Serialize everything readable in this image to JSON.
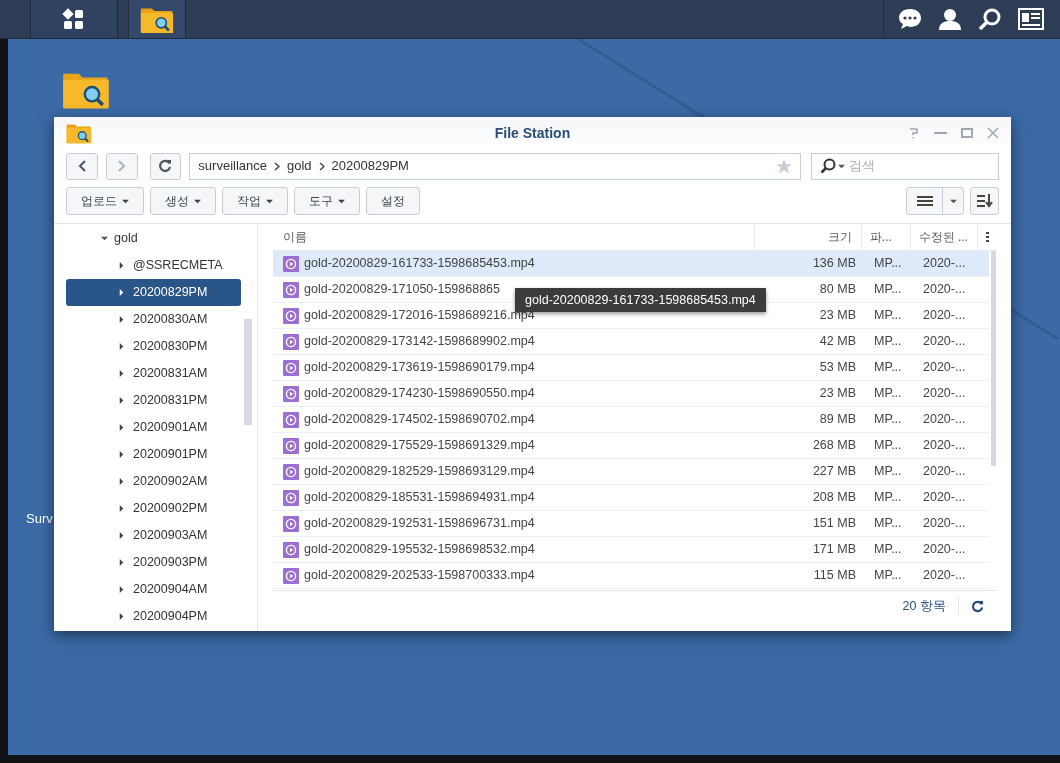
{
  "desktop": {
    "icon_label": "Surv"
  },
  "window": {
    "title": "File Station"
  },
  "path": {
    "segments": [
      "surveillance",
      "gold",
      "20200829PM"
    ]
  },
  "search": {
    "placeholder": "검색"
  },
  "toolbar": {
    "buttons": [
      {
        "label": "업로드",
        "dropdown": true
      },
      {
        "label": "생성",
        "dropdown": true
      },
      {
        "label": "작업",
        "dropdown": true
      },
      {
        "label": "도구",
        "dropdown": true
      },
      {
        "label": "설정",
        "dropdown": false
      }
    ]
  },
  "tree": {
    "label": "gold",
    "expanded": true,
    "children": [
      {
        "label": "@SSRECMETA",
        "selected": false
      },
      {
        "label": "20200829PM",
        "selected": true
      },
      {
        "label": "20200830AM",
        "selected": false
      },
      {
        "label": "20200830PM",
        "selected": false
      },
      {
        "label": "20200831AM",
        "selected": false
      },
      {
        "label": "20200831PM",
        "selected": false
      },
      {
        "label": "20200901AM",
        "selected": false
      },
      {
        "label": "20200901PM",
        "selected": false
      },
      {
        "label": "20200902AM",
        "selected": false
      },
      {
        "label": "20200902PM",
        "selected": false
      },
      {
        "label": "20200903AM",
        "selected": false
      },
      {
        "label": "20200903PM",
        "selected": false
      },
      {
        "label": "20200904AM",
        "selected": false
      },
      {
        "label": "20200904PM",
        "selected": false
      }
    ]
  },
  "table": {
    "columns": [
      "이름",
      "크기",
      "파...",
      "수정된 ..."
    ],
    "rows": [
      {
        "name": "gold-20200829-161733-1598685453.mp4",
        "size": "136 MB",
        "type": "MP...",
        "modified": "2020-...",
        "selected": true
      },
      {
        "name": "gold-20200829-171050-159868865",
        "size": "80 MB",
        "type": "MP...",
        "modified": "2020-...",
        "selected": false
      },
      {
        "name": "gold-20200829-172016-1598689216.mp4",
        "size": "23 MB",
        "type": "MP...",
        "modified": "2020-...",
        "selected": false
      },
      {
        "name": "gold-20200829-173142-1598689902.mp4",
        "size": "42 MB",
        "type": "MP...",
        "modified": "2020-...",
        "selected": false
      },
      {
        "name": "gold-20200829-173619-1598690179.mp4",
        "size": "53 MB",
        "type": "MP...",
        "modified": "2020-...",
        "selected": false
      },
      {
        "name": "gold-20200829-174230-1598690550.mp4",
        "size": "23 MB",
        "type": "MP...",
        "modified": "2020-...",
        "selected": false
      },
      {
        "name": "gold-20200829-174502-1598690702.mp4",
        "size": "89 MB",
        "type": "MP...",
        "modified": "2020-...",
        "selected": false
      },
      {
        "name": "gold-20200829-175529-1598691329.mp4",
        "size": "268 MB",
        "type": "MP...",
        "modified": "2020-...",
        "selected": false
      },
      {
        "name": "gold-20200829-182529-1598693129.mp4",
        "size": "227 MB",
        "type": "MP...",
        "modified": "2020-...",
        "selected": false
      },
      {
        "name": "gold-20200829-185531-1598694931.mp4",
        "size": "208 MB",
        "type": "MP...",
        "modified": "2020-...",
        "selected": false
      },
      {
        "name": "gold-20200829-192531-1598696731.mp4",
        "size": "151 MB",
        "type": "MP...",
        "modified": "2020-...",
        "selected": false
      },
      {
        "name": "gold-20200829-195532-1598698532.mp4",
        "size": "171 MB",
        "type": "MP...",
        "modified": "2020-...",
        "selected": false
      },
      {
        "name": "gold-20200829-202533-1598700333.mp4",
        "size": "115 MB",
        "type": "MP...",
        "modified": "2020-...",
        "selected": false
      }
    ]
  },
  "tooltip": {
    "text": "gold-20200829-161733-1598685453.mp4"
  },
  "status_bar": {
    "count": "20 항목"
  }
}
